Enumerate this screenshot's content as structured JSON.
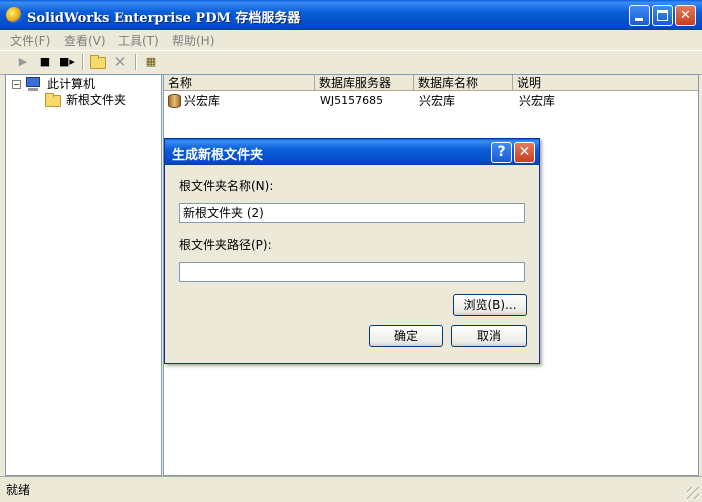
{
  "window": {
    "title": "SolidWorks Enterprise PDM 存档服务器",
    "minimize_glyph": "",
    "maximize_glyph": "",
    "close_glyph": "✕"
  },
  "menu": {
    "items": [
      {
        "label": "文件(F)"
      },
      {
        "label": "查看(V)"
      },
      {
        "label": "工具(T)"
      },
      {
        "label": "帮助(H)"
      }
    ]
  },
  "toolbar": {
    "icons": [
      "play-icon",
      "stop-icon",
      "step-icon",
      "new-folder-icon",
      "delete-icon",
      "server-icon"
    ]
  },
  "tree": {
    "root_label": "此计算机",
    "expander": "−",
    "child_label": "新根文件夹"
  },
  "list": {
    "columns": [
      "名称",
      "数据库服务器",
      "数据库名称",
      "说明"
    ],
    "rows": [
      {
        "name": "兴宏库",
        "db_server": "WJ5157685",
        "db_name": "兴宏库",
        "description": "兴宏库"
      }
    ]
  },
  "status": {
    "text": "就绪"
  },
  "dialog": {
    "title": "生成新根文件夹",
    "help_glyph": "?",
    "close_glyph": "✕",
    "name_label": "根文件夹名称(N):",
    "name_value": "新根文件夹 (2)",
    "path_label": "根文件夹路径(P):",
    "path_value": "",
    "browse_label": "浏览(B)...",
    "ok_label": "确定",
    "cancel_label": "取消"
  }
}
